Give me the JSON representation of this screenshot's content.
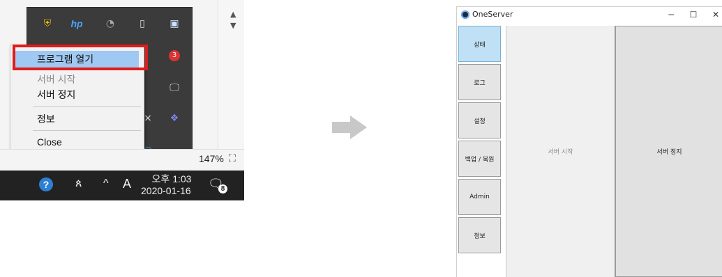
{
  "tray": {
    "context_menu": {
      "items": [
        "프로그램 열기",
        "서버 시작",
        "서버 정지",
        "정보",
        "Close"
      ]
    },
    "zoom_label": "147%",
    "taskbar": {
      "ime_label": "A",
      "ampm_time": "오후 1:03",
      "date": "2020-01-16",
      "notification_count": "8",
      "update_badge": "3"
    }
  },
  "window": {
    "title": "OneServer",
    "controls": {
      "minimize": "−",
      "maximize": "☐",
      "close": "✕"
    },
    "nav": [
      "상태",
      "로그",
      "설정",
      "백업 / 복원",
      "Admin",
      "정보"
    ],
    "active_nav": "상태",
    "actions": {
      "start": "서버 시작",
      "stop": "서버 정지"
    }
  },
  "colors": {
    "highlight_border": "#e21b1b",
    "menu_hover": "#9fc8f2",
    "nav_active": "#bfe0f5",
    "taskbar": "#222222"
  }
}
